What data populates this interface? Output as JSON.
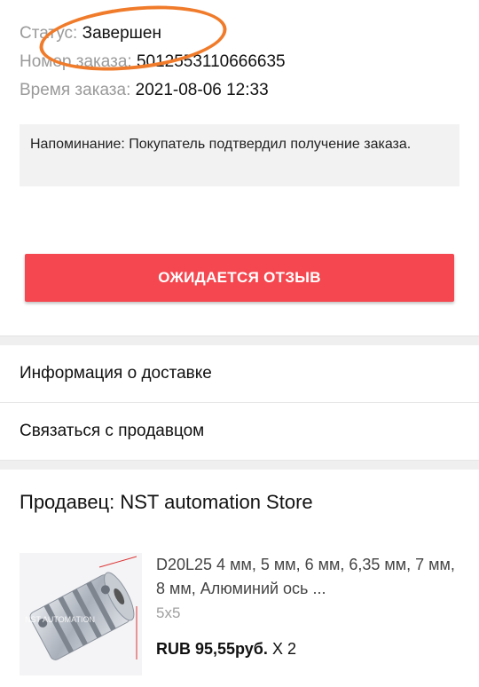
{
  "order": {
    "status_label": "Статус:",
    "status_value": "Завершен",
    "number_label": "Номер заказа:",
    "number_value": "5012553110666635",
    "time_label": "Время заказа:",
    "time_value": "2021-08-06 12:33"
  },
  "reminder": "Напоминание: Покупатель подтвердил получение заказа.",
  "review_button": "ОЖИДАЕТСЯ ОТЗЫВ",
  "links": {
    "delivery": "Информация о доставке",
    "contact": "Связаться с продавцом"
  },
  "seller": "Продавец: NST automation Store",
  "product": {
    "title": "D20L25 4 мм, 5 мм, 6 мм, 6,35 мм, 7 мм, 8 мм, Алюминий ось ...",
    "variant": "5x5",
    "price": "RUB 95,55руб.",
    "quantity": " X 2",
    "image_text": "NST AUTOMATION"
  },
  "colors": {
    "accent": "#f5474f",
    "annotation": "#f07b2a"
  }
}
